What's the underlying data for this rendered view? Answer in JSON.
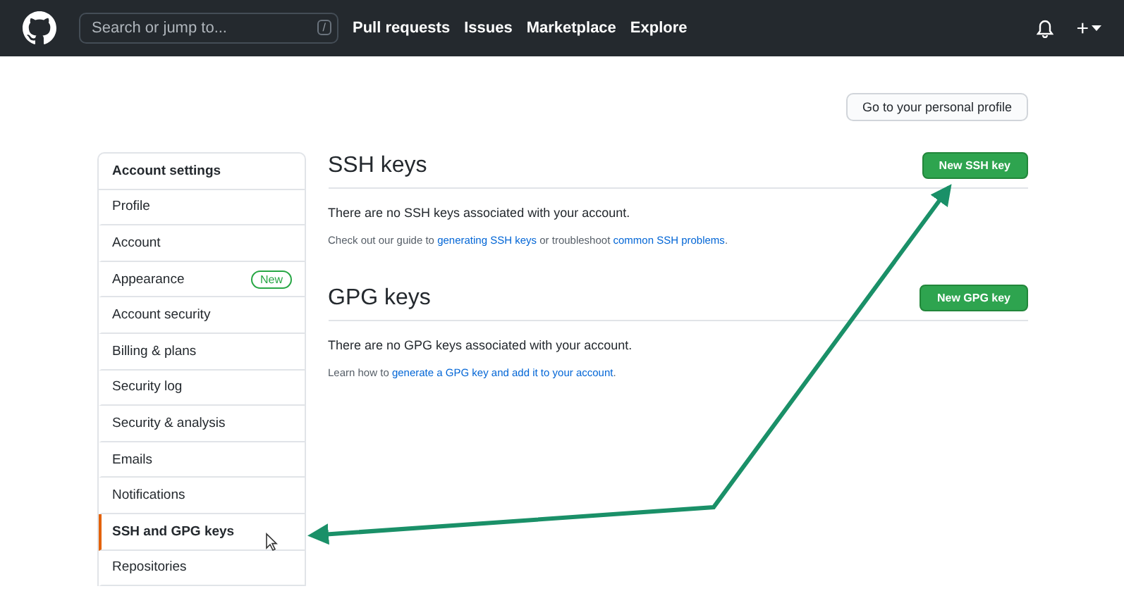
{
  "header": {
    "search": {
      "placeholder": "Search or jump to...",
      "shortcut": "/"
    },
    "nav": [
      "Pull requests",
      "Issues",
      "Marketplace",
      "Explore"
    ],
    "new_menu": "+"
  },
  "profile_button": "Go to your personal profile",
  "sidebar": {
    "title": "Account settings",
    "items": [
      {
        "label": "Profile",
        "selected": false
      },
      {
        "label": "Account",
        "selected": false
      },
      {
        "label": "Appearance",
        "selected": false,
        "badge": "New"
      },
      {
        "label": "Account security",
        "selected": false
      },
      {
        "label": "Billing & plans",
        "selected": false
      },
      {
        "label": "Security log",
        "selected": false
      },
      {
        "label": "Security & analysis",
        "selected": false
      },
      {
        "label": "Emails",
        "selected": false
      },
      {
        "label": "Notifications",
        "selected": false
      },
      {
        "label": "SSH and GPG keys",
        "selected": true
      },
      {
        "label": "Repositories",
        "selected": false
      }
    ]
  },
  "sections": [
    {
      "title": "SSH keys",
      "button": "New SSH key",
      "empty": "There are no SSH keys associated with your account.",
      "help": [
        {
          "text": "Check out our guide to ",
          "link": false
        },
        {
          "text": "generating SSH keys",
          "link": true
        },
        {
          "text": " or troubleshoot ",
          "link": false
        },
        {
          "text": "common SSH problems",
          "link": true
        },
        {
          "text": ".",
          "link": false
        }
      ]
    },
    {
      "title": "GPG keys",
      "button": "New GPG key",
      "empty": "There are no GPG keys associated with your account.",
      "help": [
        {
          "text": "Learn how to ",
          "link": false
        },
        {
          "text": "generate a GPG key and add it to your account",
          "link": true
        },
        {
          "text": ".",
          "link": false
        }
      ]
    }
  ]
}
